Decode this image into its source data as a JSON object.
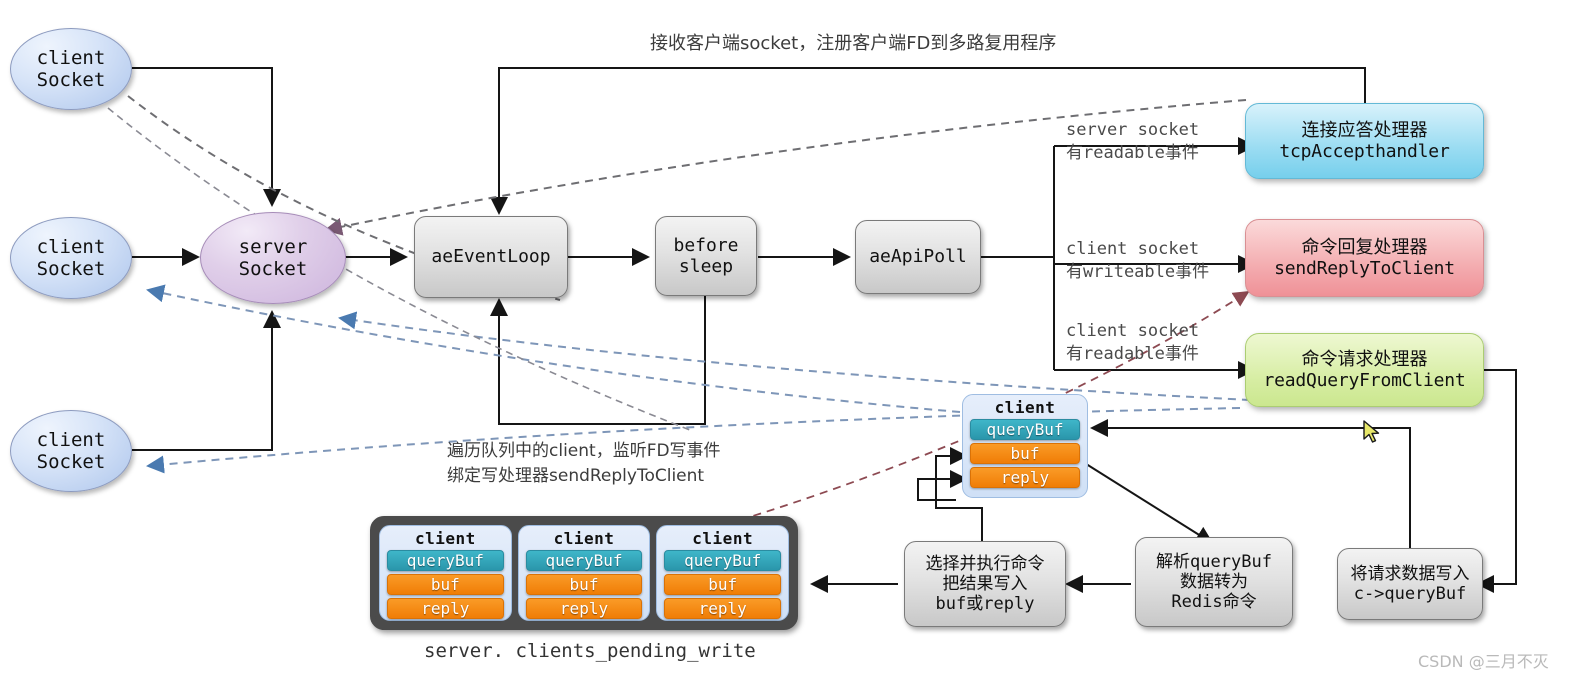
{
  "diagram": {
    "title_note_top": "接收客户端socket，注册客户端FD到多路复用程序",
    "note_beforesleep_l1": "遍历队列中的client，监听FD写事件",
    "note_beforesleep_l2": "绑定写处理器sendReplyToClient",
    "queue_caption": "server. clients_pending_write",
    "watermark": "CSDN @三月不灭"
  },
  "sockets": {
    "client_top": {
      "line1": "client",
      "line2": "Socket"
    },
    "client_mid": {
      "line1": "client",
      "line2": "Socket"
    },
    "client_bottom": {
      "line1": "client",
      "line2": "Socket"
    },
    "server": {
      "line1": "server",
      "line2": "Socket"
    }
  },
  "loop": {
    "ae_event_loop": "aeEventLoop",
    "before_sleep_l1": "before",
    "before_sleep_l2": "sleep",
    "ae_api_poll": "aeApiPoll"
  },
  "edge_labels": {
    "server_readable_l1": "server socket",
    "server_readable_l2": "有readable事件",
    "client_writeable_l1": "client socket",
    "client_writeable_l2": "有writeable事件",
    "client_readable_l1": "client socket",
    "client_readable_l2": "有readable事件"
  },
  "handlers": [
    {
      "name_cn": "连接应答处理器",
      "fn": "tcpAccepthandler",
      "color": "#8ed9ef"
    },
    {
      "name_cn": "命令回复处理器",
      "fn": "sendReplyToClient",
      "color": "#f3a3a8"
    },
    {
      "name_cn": "命令请求处理器",
      "fn": "readQueryFromClient",
      "color": "#d2ea96"
    }
  ],
  "client_struct": {
    "title": "client",
    "fields": [
      "queryBuf",
      "buf",
      "reply"
    ],
    "colors": {
      "queryBuf": "#2f9fb4",
      "buf": "#f58507",
      "reply": "#f58507"
    }
  },
  "pending_queue": {
    "clients": [
      {
        "title": "client",
        "fields": [
          "queryBuf",
          "buf",
          "reply"
        ]
      },
      {
        "title": "client",
        "fields": [
          "queryBuf",
          "buf",
          "reply"
        ]
      },
      {
        "title": "client",
        "fields": [
          "queryBuf",
          "buf",
          "reply"
        ]
      }
    ]
  },
  "steps": {
    "write_query": {
      "l1": "将请求数据写入",
      "l2": "c->queryBuf"
    },
    "parse_query": {
      "l1": "解析queryBuf",
      "l2": "数据转为",
      "l3": "Redis命令"
    },
    "exec_cmd": {
      "l1": "选择并执行命令",
      "l2": "把结果写入",
      "l3": "buf或reply"
    }
  }
}
